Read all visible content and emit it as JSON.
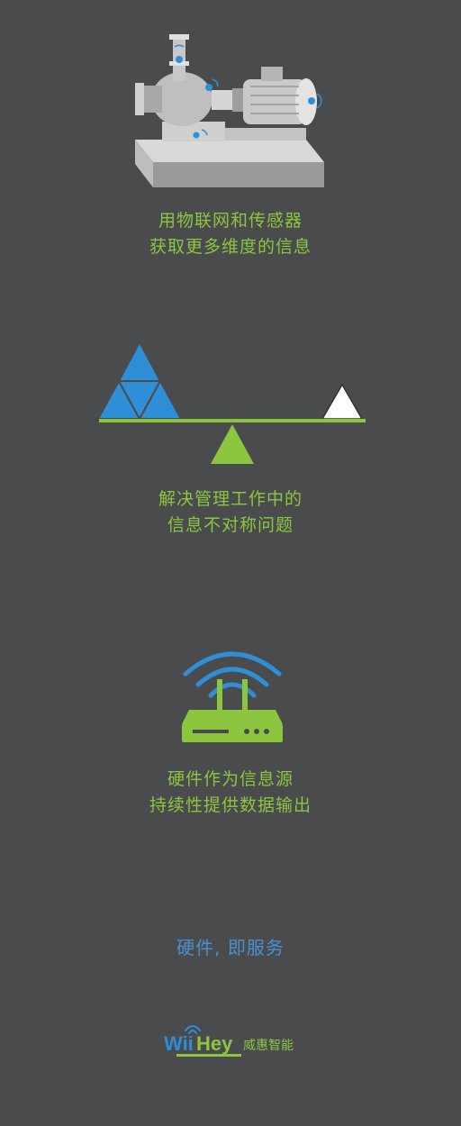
{
  "sections": [
    {
      "line1": "用物联网和传感器",
      "line2": "获取更多维度的信息"
    },
    {
      "line1": "解决管理工作中的",
      "line2": "信息不对称问题"
    },
    {
      "line1": "硬件作为信息源",
      "line2": "持续性提供数据输出"
    }
  ],
  "tagline": "硬件, 即服务",
  "logo": {
    "brand": "WiiHey",
    "cn": "威惠智能"
  },
  "colors": {
    "background": "#4a4b4d",
    "green": "#8cc63f",
    "blue": "#2f8fd6"
  }
}
